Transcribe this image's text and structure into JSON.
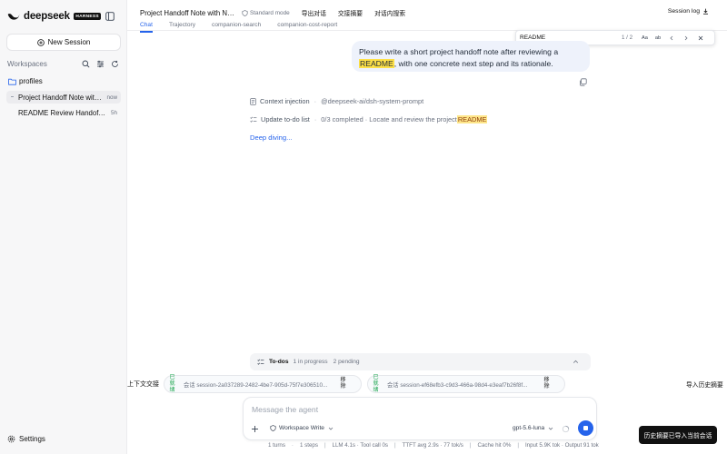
{
  "brand": {
    "name": "deepseek",
    "badge": "HARNESS"
  },
  "sidebar": {
    "new_session_label": "New Session",
    "workspaces_label": "Workspaces",
    "folder": {
      "label": "profiles",
      "icon": "folder-icon"
    },
    "sessions": [
      {
        "name": "Project Handoff Note with Ne...",
        "time": "now",
        "active": true
      },
      {
        "name": "README Review Handoff Note",
        "time": "5h",
        "active": false
      }
    ],
    "settings_label": "Settings"
  },
  "header": {
    "title": "Project Handoff Note with Nex...",
    "mode": "Standard mode",
    "links": [
      "导出对话",
      "交接摘要",
      "对话内搜索"
    ],
    "session_log": "Session log",
    "tabs": [
      {
        "label": "Chat",
        "active": true
      },
      {
        "label": "Trajectory",
        "active": false
      },
      {
        "label": "companion-search",
        "active": false
      },
      {
        "label": "companion-cost-report",
        "active": false
      }
    ]
  },
  "find": {
    "value": "README",
    "count": "1 / 2",
    "case_btn": "Aa",
    "word_btn": "ab"
  },
  "message": {
    "before": "Please write a short project handoff note after reviewing a ",
    "highlight": "README",
    "after": ", with one concrete next step and its rationale."
  },
  "tool_calls": {
    "context": {
      "label": "Context injection",
      "meta": "@deepseek-ai/dsh-system-prompt"
    },
    "todo": {
      "label": "Update to-do list",
      "meta_before": "0/3 completed · Locate and review the project ",
      "meta_highlight": "README"
    },
    "deep_diving": "Deep diving..."
  },
  "todos": {
    "label": "To-dos",
    "in_progress": "1 in progress",
    "pending": "2 pending"
  },
  "context_handoff": {
    "label": "上下文交接",
    "chips": [
      {
        "status": "已就绪",
        "name": "会话 session-2a037289-2482-4be7-905d-75f7e306510...",
        "remove": "移除"
      },
      {
        "status": "已就绪",
        "name": "会话 session-ef68efb3-c9d3-466a-98d4-e3eaf7b26f8f...",
        "remove": "移除"
      }
    ],
    "import_label": "导入历史摘要"
  },
  "composer": {
    "placeholder": "Message the agent",
    "workspace_mode": "Workspace Write",
    "model": "gpt-5.6-luna"
  },
  "status": {
    "turns": "1 turns",
    "steps": "1 steps",
    "llm": "LLM 4.1s · Tool call 0s",
    "ttft": "TTFT avg 2.9s · 77 tok/s",
    "cache": "Cache hit 0%",
    "tokens": "Input 5.9K tok · Output 91 tok"
  },
  "toast": "历史摘要已导入当前会话",
  "colors": {
    "accent": "#2563eb",
    "highlight": "#fde047",
    "bubble": "#eef2fb",
    "ready": "#16a34a"
  }
}
